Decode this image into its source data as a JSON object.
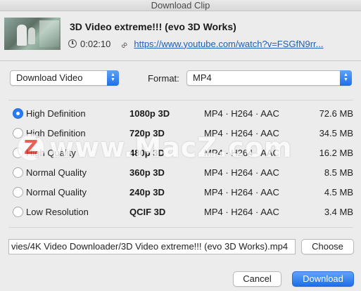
{
  "window": {
    "title": "Download Clip"
  },
  "clip": {
    "title": "3D Video extreme!!! (evo 3D Works)",
    "duration": "0:02:10",
    "url": "https://www.youtube.com/watch?v=FSGfN9rr..."
  },
  "controls": {
    "mode_value": "Download Video",
    "format_label": "Format:",
    "format_value": "MP4"
  },
  "options": [
    {
      "quality": "High Definition",
      "resolution": "1080p  3D",
      "codec": "MP4 · H264 · AAC",
      "size": "72.6 MB",
      "selected": true
    },
    {
      "quality": "High Definition",
      "resolution": "720p  3D",
      "codec": "MP4 · H264 · AAC",
      "size": "34.5 MB",
      "selected": false
    },
    {
      "quality": "High Quality",
      "resolution": "480p  3D",
      "codec": "MP4 · H264 · AAC",
      "size": "16.2 MB",
      "selected": false
    },
    {
      "quality": "Normal Quality",
      "resolution": "360p  3D",
      "codec": "MP4 · H264 · AAC",
      "size": "8.5 MB",
      "selected": false
    },
    {
      "quality": "Normal Quality",
      "resolution": "240p  3D",
      "codec": "MP4 · H264 · AAC",
      "size": "4.5 MB",
      "selected": false
    },
    {
      "quality": "Low Resolution",
      "resolution": "QCIF  3D",
      "codec": "MP4 · H264 · AAC",
      "size": "3.4 MB",
      "selected": false
    }
  ],
  "watermark": {
    "logo_letter": "Z",
    "text": "www.MacZ.com"
  },
  "save": {
    "path": "vies/4K Video Downloader/3D Video extreme!!! (evo 3D Works).mp4",
    "choose_label": "Choose"
  },
  "footer": {
    "cancel_label": "Cancel",
    "download_label": "Download"
  },
  "colors": {
    "accent": "#1d6fe8",
    "link": "#1f5fb4",
    "watermark_logo": "#e43b2c"
  }
}
